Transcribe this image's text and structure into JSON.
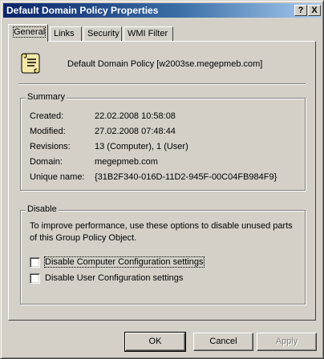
{
  "window": {
    "title": "Default Domain Policy Properties",
    "help_glyph": "?",
    "close_glyph": "X"
  },
  "tabs": [
    {
      "label": "General",
      "active": true
    },
    {
      "label": "Links",
      "active": false
    },
    {
      "label": "Security",
      "active": false
    },
    {
      "label": "WMI Filter",
      "active": false
    }
  ],
  "header": {
    "icon": "group-policy-scroll-icon",
    "policy_name": "Default Domain Policy [w2003se.megepmeb.com]"
  },
  "summary": {
    "legend": "Summary",
    "rows": [
      {
        "label": "Created:",
        "value": "22.02.2008 10:58:08"
      },
      {
        "label": "Modified:",
        "value": "27.02.2008 07:48:44"
      },
      {
        "label": "Revisions:",
        "value": "13 (Computer), 1 (User)"
      },
      {
        "label": "Domain:",
        "value": "megepmeb.com"
      },
      {
        "label": "Unique name:",
        "value": "{31B2F340-016D-11D2-945F-00C04FB984F9}"
      }
    ]
  },
  "disable": {
    "legend": "Disable",
    "description": "To improve performance, use these options to disable unused parts of this Group Policy Object.",
    "options": [
      {
        "label": "Disable Computer Configuration settings",
        "checked": false,
        "focused": true
      },
      {
        "label": "Disable User Configuration settings",
        "checked": false,
        "focused": false
      }
    ]
  },
  "buttons": {
    "ok": "OK",
    "cancel": "Cancel",
    "apply": "Apply"
  }
}
